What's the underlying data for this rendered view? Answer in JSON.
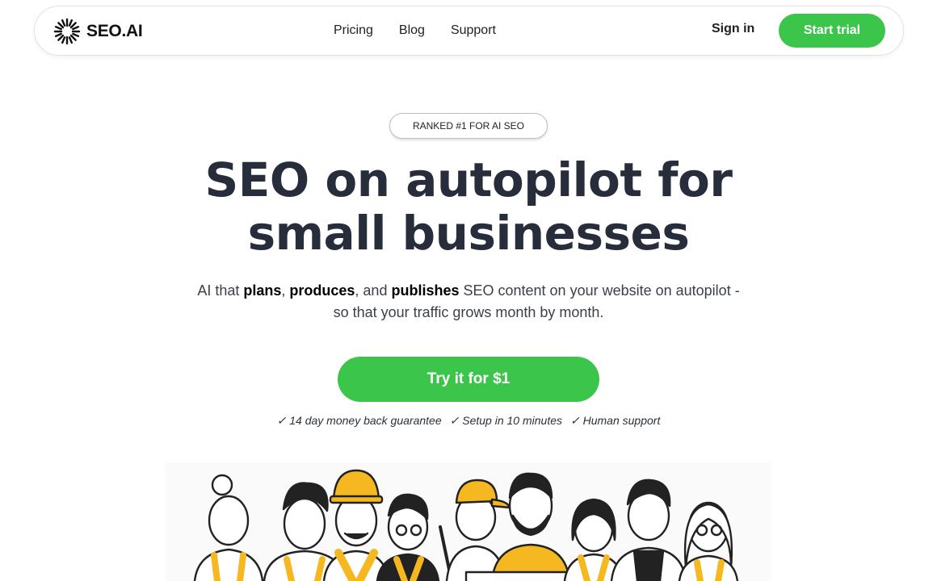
{
  "nav": {
    "logo_text": "SEO.AI",
    "links": [
      "Pricing",
      "Blog",
      "Support"
    ],
    "sign_in": "Sign in",
    "start_trial": "Start trial"
  },
  "hero": {
    "badge": "RANKED #1 FOR AI SEO",
    "headline_line1": "SEO on autopilot for",
    "headline_line2": "small businesses",
    "sub": {
      "p1": "AI that ",
      "b1": "plans",
      "p2": ", ",
      "b2": "produces",
      "p3": ", and ",
      "b3": "publishes",
      "p4": " SEO content on your website on autopilot - so that your traffic grows month by month."
    },
    "cta": "Try it for $1",
    "guarantees": [
      "✓ 14 day money back guarantee",
      "✓ Setup in 10 minutes",
      "✓ Human support"
    ]
  },
  "colors": {
    "accent_green": "#3bc54b",
    "heading": "#272d3b",
    "illustration_yellow": "#f5b821"
  }
}
